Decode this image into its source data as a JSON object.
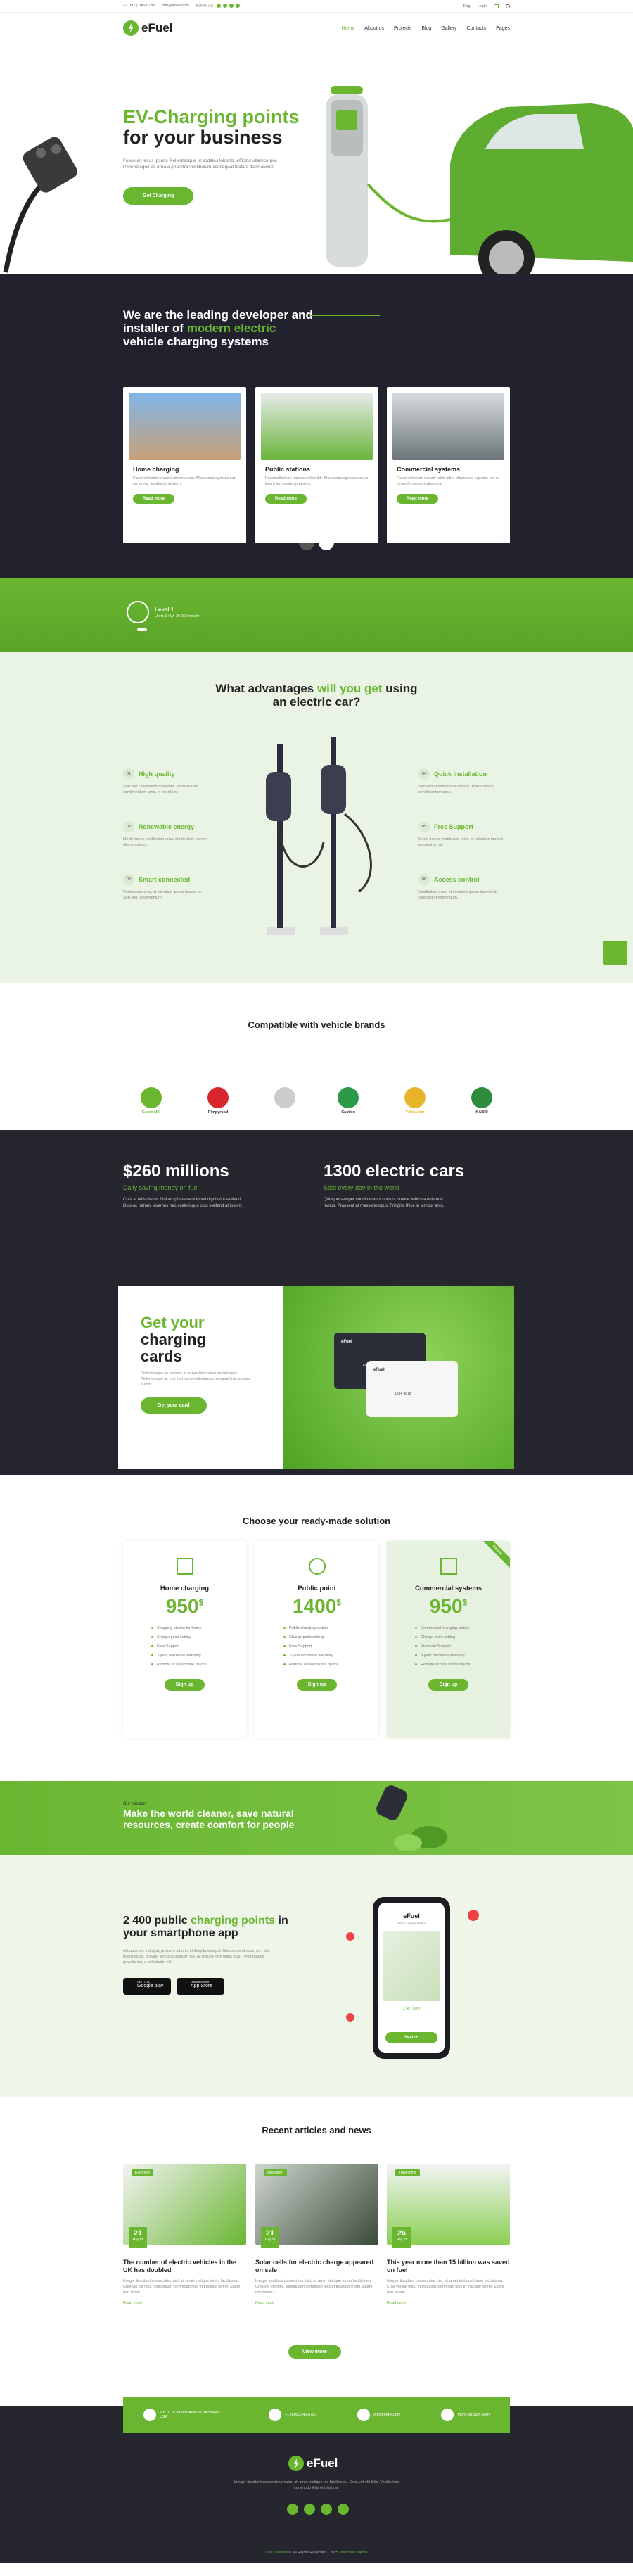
{
  "topbar": {
    "phone": "+1 (800) 345-6789",
    "email": "info@efuel.com",
    "follow": "Follow us:",
    "lang": "Eng",
    "login": "Login"
  },
  "header": {
    "logo": "eFuel",
    "nav": [
      "Home",
      "About us",
      "Projects",
      "Blog",
      "Gallery",
      "Contacts",
      "Pages"
    ]
  },
  "hero": {
    "title1": "EV-Charging points",
    "title2": "for your business",
    "text": "Fusce ac lacus ipsum. Pellentesque ut sodales lobortis, efficitur ullamcorper. Pellentesque ac urna a pharetra vestibulum consequat finibus diam auctor.",
    "button": "Get Charging"
  },
  "dev": {
    "title1": "We are the leading developer and",
    "title2a": "installer of ",
    "title2b": "modern electric",
    "title3": "vehicle charging systems",
    "cards": [
      {
        "title": "Home charging",
        "text": "Fusamellentum mauris ultrices urna. Maecenas egestas est eu lorem, tincidunt interdum.",
        "button": "Read more"
      },
      {
        "title": "Public stations",
        "text": "Fusamellentum mauris nulla nibh. Maecenas egestas est eu lorem fermentum pharetra.",
        "button": "Read more"
      },
      {
        "title": "Commercial systems",
        "text": "Fusamellentum mauris nulla nibh. Maecenas egestas est eu lorem fermentum pharetra.",
        "button": "Read more"
      }
    ]
  },
  "level": {
    "title": "Level 1",
    "text": "Up to 3 kW, 20-30 mins/hr"
  },
  "adv": {
    "title1": "What advantages ",
    "title1g": "will you get",
    "title1c": " using",
    "title2": "an electric car?",
    "features": [
      {
        "n": "01",
        "title": "High quality",
        "text": "Sed sed condimentum massa. Morbi rutrum condimentum urna, et interdum."
      },
      {
        "n": "02",
        "title": "Renewable energy",
        "text": "Morbi nonne vestibulum urna, et interdum laoreet elementum ut."
      },
      {
        "n": "03",
        "title": "Smart connected",
        "text": "Vestibulum urna, et interdum ipsum laoreet ut. Sed sed condimentum."
      },
      {
        "n": "04",
        "title": "Quick installation",
        "text": "Sed sed condimentum massa. Morbi rutrum condimentum urna."
      },
      {
        "n": "05",
        "title": "Free Support",
        "text": "Morbi nonne vestibulum urna, et interdum laoreet elementum ut."
      },
      {
        "n": "06",
        "title": "Access control",
        "text": "Vestibulum urna, et interdum ipsum laoreet ut. Sed sed condimentum."
      }
    ]
  },
  "brands": {
    "title": "Compatible with vehicle brands",
    "items": [
      {
        "name": "Green Mill",
        "color": "#6ab631"
      },
      {
        "name": "Pimpyroad",
        "color": "#d8262d"
      },
      {
        "name": "",
        "color": "#cccccc"
      },
      {
        "name": "Castlex",
        "color": "#2d9a4a"
      },
      {
        "name": "Yellowstar",
        "color": "#e9b528"
      },
      {
        "name": "KABRI",
        "color": "#2e8c3f"
      }
    ]
  },
  "stats": {
    "s1": {
      "value": "$260 millions",
      "sub": "Daily saving money on fuel",
      "text": "Cras at felis metus. Nullam pharetra odio vel dignissim eleifend. Duis ac rutrum, vivamus nec scelerisque cras eleifend at ipsum."
    },
    "s2": {
      "value": "1300 electric cars",
      "sub": "Sold every day in the world",
      "text": "Quisque semper condimentum cursus, ornare vehicula euismod metus. Praesent at massa tempus. Fringilla thice in tempor arcu."
    }
  },
  "cards": {
    "title1": "Get your",
    "title2": "charging",
    "title3": "cards",
    "text": "Pellentesque ac semper in neque bibendum scelerisque. Pellentesque ac orci sed nisi vestibulum consequat finibus diam auctor.",
    "button": "Get your card",
    "c1": "eFuel",
    "c2": "eFuel",
    "num1": "1234 5678",
    "num2": "1234 5678"
  },
  "plans": {
    "title": "Choose your ready-made solution",
    "items": [
      {
        "title": "Home charging",
        "price": "950",
        "cur": "$",
        "feat": [
          "Charging station for home",
          "Charge point setting",
          "Free Support",
          "2-year hardware warranty",
          "Remote access to the device"
        ],
        "button": "Sign up"
      },
      {
        "title": "Public point",
        "price": "1400",
        "cur": "$",
        "feat": [
          "Public charging station",
          "Charge point setting",
          "Free Support",
          "2-year hardware warranty",
          "Remote access to the device"
        ],
        "button": "Sign up"
      },
      {
        "title": "Commercial systems",
        "price": "950",
        "cur": "$",
        "feat": [
          "Commercial charging station",
          "Charge point setting",
          "Premium Support",
          "3-year hardware warranty",
          "Remote access to the device"
        ],
        "button": "Sign up",
        "badge": "Popular"
      }
    ]
  },
  "mission": {
    "label": "Our mission",
    "title1": "Make the world cleaner, save natural",
    "title2": "resources, create comfort for people"
  },
  "app": {
    "title1": "2 400 public ",
    "title1g": "charging points",
    "title1c": " in",
    "title2": "your smartphone app",
    "text": "Aliquam nec volutpat, posuere lobortis id fringilla volutpat. Maecenas ultrices, orci dui mattis ligula, gravida lectus sollicitudin dui, ac mauris sem tellus quis. Proin mauris gravida dui, a sollicitudin elit.",
    "gp": "Google play",
    "as": "App Store",
    "gp_small": "GET IT ON",
    "as_small": "Download on the",
    "phone_logo": "eFuel",
    "phone_label": "Find a charge station",
    "phone_btn": "Search",
    "phone_price": "2.45 / kWh"
  },
  "news": {
    "title": "Recent articles and news",
    "items": [
      {
        "tag": "Electricity",
        "day": "21",
        "month": "May 23",
        "title": "The number of electric vehicles in the UK has doubled",
        "text": "Integer tincidunt consectetur nisi, sit amet tristique lorem facilisis eu. Cras vel elit felis. Vestibulum commodo felis et tristique lorem. Etiam non lorem.",
        "more": "Read more"
      },
      {
        "tag": "Innovation",
        "day": "21",
        "month": "May 23",
        "title": "Solar cells for electric charge appeared on sale",
        "text": "Integer tincidunt consectetur nisi, sit amet tristique lorem facilisis eu. Cras vel elit felis. Vestibulum commodo felis et tristique lorem. Etiam non lorem.",
        "more": "Read more"
      },
      {
        "tag": "Travel time",
        "day": "26",
        "month": "May 23",
        "title": "This year more than 15 billion was saved on fuel",
        "text": "Integer tincidunt consectetur nisi, sit amet tristique lorem facilisis eu. Cras vel elit felis. Vestibulum commodo felis et tristique lorem. Etiam non lorem.",
        "more": "Read more"
      }
    ],
    "button": "View more"
  },
  "footer": {
    "contacts": [
      "NY 10 St Albans Avenue, Brooklyn, USA",
      "+1 (800) 345-6789",
      "info@efuel.com",
      "Mon-Sat 9am-6pm"
    ],
    "logo": "eFuel",
    "text": "Integer tincidunt consectetur nunc, sit amet tristique leo facilisis eu. Cras vel elit felis. Vestibulum commodo felis et tristique.",
    "copy1": "Link Themes",
    "copy2": " © All Rights Reserved - 2025 ",
    "copy3": "Purchase theme"
  }
}
